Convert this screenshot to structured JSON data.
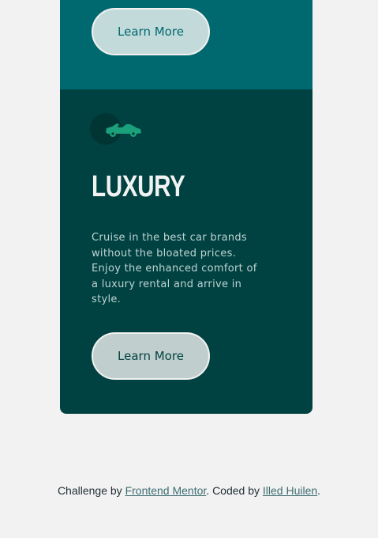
{
  "top_card": {
    "button_label": "Learn More"
  },
  "luxury_card": {
    "icon": "luxury-car-icon",
    "title": "LUXURY",
    "description": "Cruise in the best car brands without the bloated prices. Enjoy the enhanced comfort of a luxury rental and arrive in style.",
    "button_label": "Learn More"
  },
  "footer": {
    "prefix": "Challenge by ",
    "link1": "Frontend Mentor",
    "middle": ". Coded by ",
    "link2": "Illed Huilen",
    "suffix": "."
  },
  "colors": {
    "page_background": "#f2f2f2",
    "sedans_teal": "#006970",
    "luxury_dark_cyan": "#004241",
    "button_border": "#f2f2f2",
    "icon_accent": "#1aa07a"
  }
}
